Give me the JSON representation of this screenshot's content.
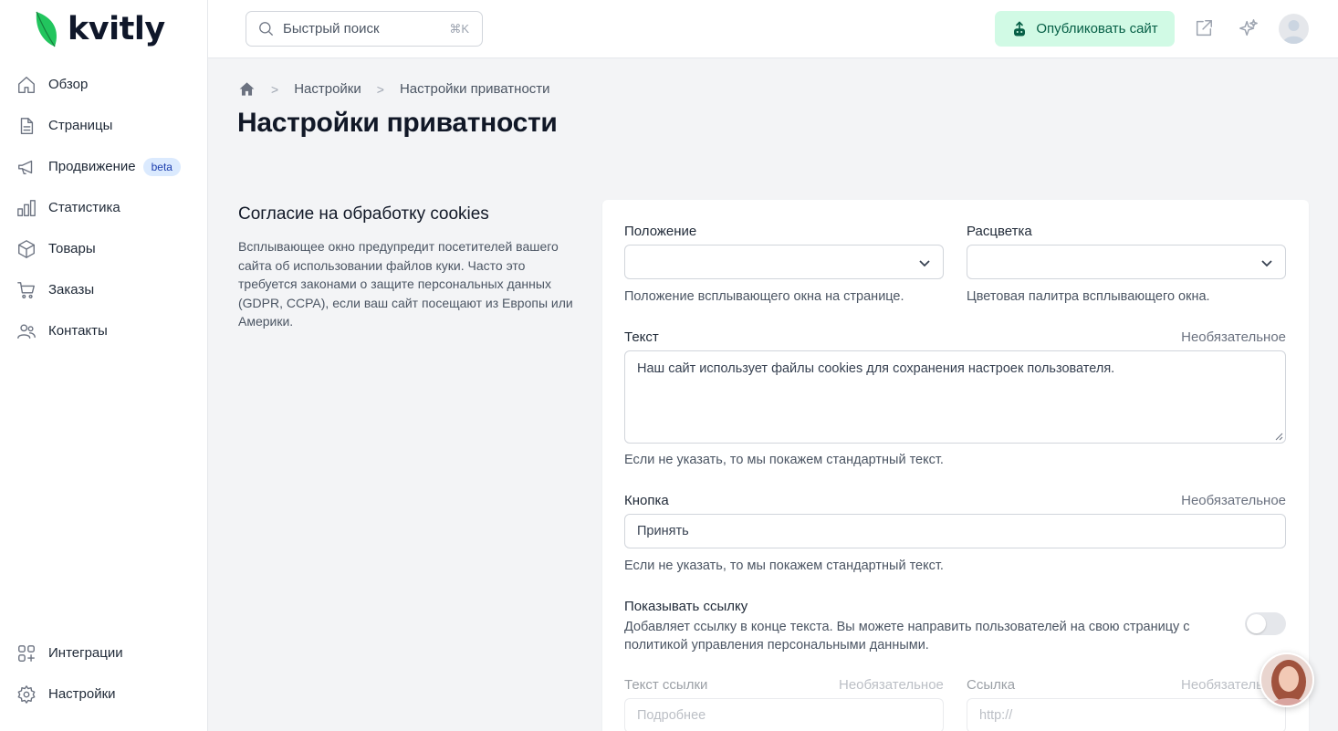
{
  "brand": {
    "name": "kvitly",
    "accent": "#22c55e"
  },
  "sidebar": {
    "items": [
      {
        "label": "Обзор",
        "icon": "home-icon"
      },
      {
        "label": "Страницы",
        "icon": "document-icon"
      },
      {
        "label": "Продвижение",
        "icon": "megaphone-icon",
        "badge": "beta"
      },
      {
        "label": "Статистика",
        "icon": "chart-icon"
      },
      {
        "label": "Товары",
        "icon": "box-icon"
      },
      {
        "label": "Заказы",
        "icon": "cart-icon"
      },
      {
        "label": "Контакты",
        "icon": "users-icon"
      }
    ],
    "bottom_items": [
      {
        "label": "Интеграции",
        "icon": "integrations-icon"
      },
      {
        "label": "Настройки",
        "icon": "gear-icon"
      }
    ]
  },
  "header": {
    "search_placeholder": "Быстрый поиск",
    "search_shortcut": "⌘K",
    "publish_label": "Опубликовать сайт"
  },
  "breadcrumb": [
    "Настройки",
    "Настройки приватности"
  ],
  "page_title": "Настройки приватности",
  "section": {
    "title": "Согласие на обработку cookies",
    "description": "Всплывающее окно предупредит посетителей вашего сайта об использовании файлов куки. Часто это требуется законами о защите персональных данных (GDPR, CCPA), если ваш сайт посещают из Европы или Америки."
  },
  "form": {
    "position": {
      "label": "Положение",
      "value": "",
      "hint": "Положение всплывающего окна на странице."
    },
    "color": {
      "label": "Расцветка",
      "value": "",
      "hint": "Цветовая палитра всплывающего окна."
    },
    "text": {
      "label": "Текст",
      "optional": "Необязательное",
      "value": "Наш сайт использует файлы cookies для сохранения настроек пользователя.",
      "hint": "Если не указать, то мы покажем стандартный текст."
    },
    "button": {
      "label": "Кнопка",
      "optional": "Необязательное",
      "value": "Принять",
      "hint": "Если не указать, то мы покажем стандартный текст."
    },
    "show_link": {
      "label": "Показывать ссылку",
      "description": "Добавляет ссылку в конце текста. Вы можете направить пользователей на свою страницу с политикой управления персональными данными.",
      "enabled": false
    },
    "link_text": {
      "label": "Текст ссылки",
      "optional": "Необязательное",
      "placeholder": "Подробнее"
    },
    "link_url": {
      "label": "Ссылка",
      "optional": "Необязательное",
      "placeholder": "http://"
    }
  }
}
